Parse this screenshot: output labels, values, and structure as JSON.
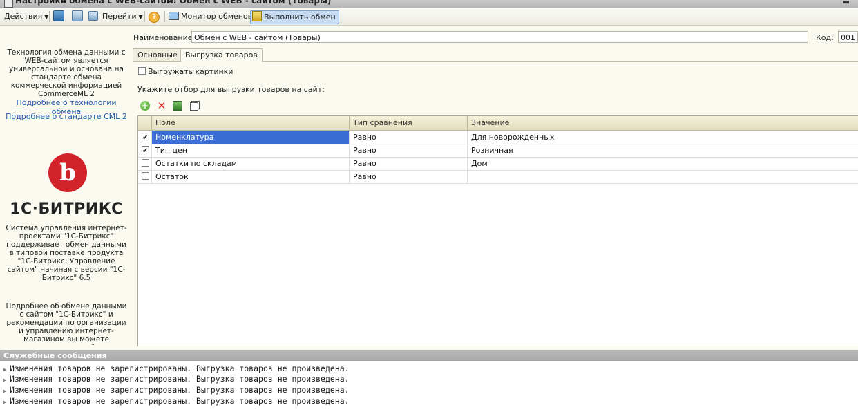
{
  "window": {
    "title": "Настройки обмена с WEB-сайтом: Обмен с WEB - сайтом (Товары)"
  },
  "toolbar": {
    "actions_label": "Действия",
    "goto_label": "Перейти",
    "monitor_label": "Монитор обменов",
    "execute_label": "Выполнить обмен",
    "help_symbol": "?"
  },
  "sidebar": {
    "intro_text": "Технология обмена данными с WEB-сайтом является универсальной и основана на стандарте обмена коммерческой информацией CommerceML 2",
    "link_tech": "Подробнее о технологии обмена",
    "link_cml": "Подробнее о стандарте CML 2",
    "logo_letter": "b",
    "brand": "1С·БИТРИКС",
    "cms_text": "Система управления интернет-проектами \"1С-Битрикс\" поддерживает обмен данными в типовой поставке продукта \"1С-Битрикс: Управление сайтом\" начиная с версии \"1С-Битрикс\" 6.5",
    "more_text": "Подробнее об обмене данными с сайтом \"1С-Битрикс\" и рекомендации по организации и управлению интернет-магазином вы можете прочитать на сайте"
  },
  "form": {
    "name_label": "Наименование:",
    "name_value": "Обмен с WEB - сайтом (Товары)",
    "code_label": "Код:",
    "code_value": "001",
    "tabs": [
      "Основные",
      "Выгрузка товаров"
    ],
    "export_images_label": "Выгружать картинки",
    "export_images_checked": false,
    "filter_label": "Укажите отбор для выгрузки товаров на сайт:"
  },
  "grid": {
    "columns": [
      "Поле",
      "Тип сравнения",
      "Значение"
    ],
    "rows": [
      {
        "checked": true,
        "field": "Номенклатура",
        "comparison": "Равно",
        "value": "Для новорожденных"
      },
      {
        "checked": true,
        "field": "Тип цен",
        "comparison": "Равно",
        "value": "Розничная"
      },
      {
        "checked": false,
        "field": "Остатки по складам",
        "comparison": "Равно",
        "value": "Дом"
      },
      {
        "checked": false,
        "field": "Остаток",
        "comparison": "Равно",
        "value": ""
      }
    ]
  },
  "messages": {
    "title": "Служебные сообщения",
    "items": [
      "Изменения товаров не зарегистрированы. Выгрузка товаров не произведена.",
      "Изменения товаров не зарегистрированы. Выгрузка товаров не произведена.",
      "Изменения товаров не зарегистрированы. Выгрузка товаров не произведена.",
      "Изменения товаров не зарегистрированы. Выгрузка товаров не произведена."
    ]
  },
  "colors": {
    "selection": "#3b6dd4",
    "link": "#2254a8",
    "brand_red": "#d2232a"
  }
}
